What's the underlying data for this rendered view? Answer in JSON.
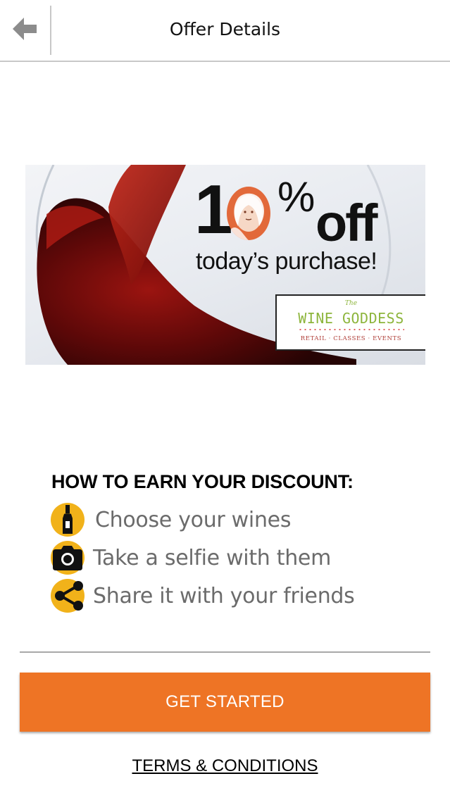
{
  "header": {
    "title": "Offer Details",
    "back_icon": "arrow-left-icon"
  },
  "banner": {
    "offer_digit": "1",
    "offer_percent": "%",
    "offer_off": "off",
    "offer_subtitle": "today’s purchase!",
    "logo": {
      "the": "The",
      "name": "WINE GODDESS",
      "tagline": "RETAIL · CLASSES · EVENTS"
    }
  },
  "howto": {
    "title": "HOW TO EARN YOUR DISCOUNT:",
    "steps": [
      {
        "icon": "wine-bottle-icon",
        "label": "Choose your wines"
      },
      {
        "icon": "camera-icon",
        "label": "Take a selfie with them"
      },
      {
        "icon": "share-icon",
        "label": "Share it with your friends"
      }
    ]
  },
  "actions": {
    "get_started": "GET STARTED",
    "terms": "TERMS & CONDITIONS"
  },
  "colors": {
    "accent": "#ee7425",
    "icon_yellow": "#f1b21a",
    "logo_green": "#8db53c"
  }
}
